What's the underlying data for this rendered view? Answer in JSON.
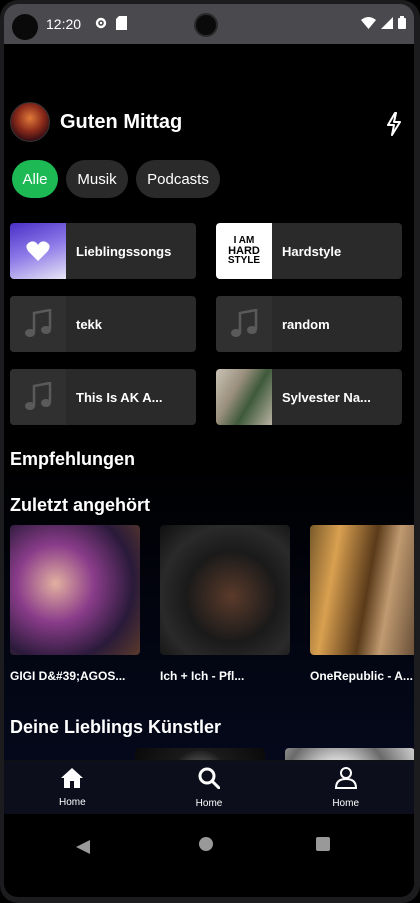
{
  "status_bar": {
    "time": "12:20",
    "icons": [
      "settings-icon",
      "sd-card-icon",
      "wifi-icon",
      "signal-icon",
      "battery-icon"
    ]
  },
  "header": {
    "greeting": "Guten Mittag",
    "action_icon": "lightning-icon"
  },
  "chips": [
    {
      "label": "Alle",
      "active": true
    },
    {
      "label": "Musik",
      "active": false
    },
    {
      "label": "Podcasts",
      "active": false
    }
  ],
  "shortcuts": [
    {
      "label": "Lieblingssongs",
      "art": "heart"
    },
    {
      "label": "Hardstyle",
      "art": "hardstyle"
    },
    {
      "label": "tekk",
      "art": "note"
    },
    {
      "label": "random",
      "art": "note"
    },
    {
      "label": "This Is AK A...",
      "art": "note"
    },
    {
      "label": "Sylvester Na...",
      "art": "photo"
    }
  ],
  "hardstyle_art_text": [
    "I AM",
    "HARD",
    "STYLE"
  ],
  "sections": {
    "recommendations": "Empfehlungen",
    "recent": "Zuletzt angehört",
    "artists": "Deine Lieblings Künstler"
  },
  "recent_items": [
    {
      "label": "GIGI D&#39;AGOS..."
    },
    {
      "label": "Ich + Ich - Pfl..."
    },
    {
      "label": "OneRepublic - A..."
    }
  ],
  "bottom_nav": [
    {
      "label": "Home",
      "icon": "home-icon"
    },
    {
      "label": "Home",
      "icon": "search-icon"
    },
    {
      "label": "Home",
      "icon": "person-icon"
    }
  ],
  "colors": {
    "accent": "#1db954",
    "tile_bg": "#2a2a2a",
    "nav_bg": "#0c0e1c"
  }
}
